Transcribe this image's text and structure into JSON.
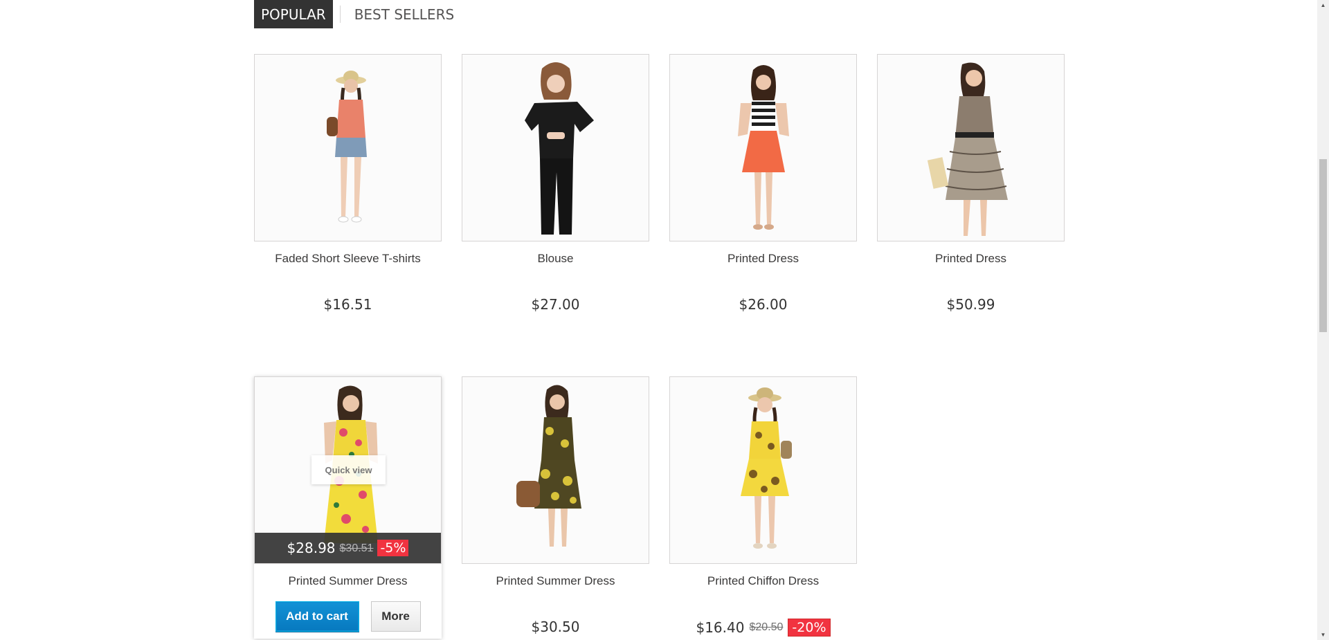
{
  "tabs": [
    {
      "label": "POPULAR",
      "active": true
    },
    {
      "label": "BEST SELLERS",
      "active": false
    }
  ],
  "products": [
    {
      "name": "Faded Short Sleeve T-shirts",
      "price": "$16.51",
      "old_price": "",
      "discount": "",
      "outfit": "tshirt-shorts"
    },
    {
      "name": "Blouse",
      "price": "$27.00",
      "old_price": "",
      "discount": "",
      "outfit": "black-blouse"
    },
    {
      "name": "Printed Dress",
      "price": "$26.00",
      "old_price": "",
      "discount": "",
      "outfit": "striped-orange"
    },
    {
      "name": "Printed Dress",
      "price": "$50.99",
      "old_price": "",
      "discount": "",
      "outfit": "animal-print"
    },
    {
      "name": "Printed Summer Dress",
      "price": "$28.98",
      "old_price": "$30.51",
      "discount": "-5%",
      "outfit": "yellow-floral-long",
      "hovered": true
    },
    {
      "name": "Printed Summer Dress",
      "price": "$30.50",
      "old_price": "",
      "discount": "",
      "outfit": "olive-floral"
    },
    {
      "name": "Printed Chiffon Dress",
      "price": "$16.40",
      "old_price": "$20.50",
      "discount": "-20%",
      "outfit": "yellow-chiffon"
    }
  ],
  "hover": {
    "quick_view_label": "Quick view",
    "add_to_cart_label": "Add to cart",
    "more_label": "More"
  },
  "colors": {
    "tab_active_bg": "#333333",
    "discount_red": "#f13340",
    "cart_blue": "#0f8fd2"
  },
  "icons": [
    "scroll-up-arrow-icon",
    "scroll-down-arrow-icon"
  ]
}
